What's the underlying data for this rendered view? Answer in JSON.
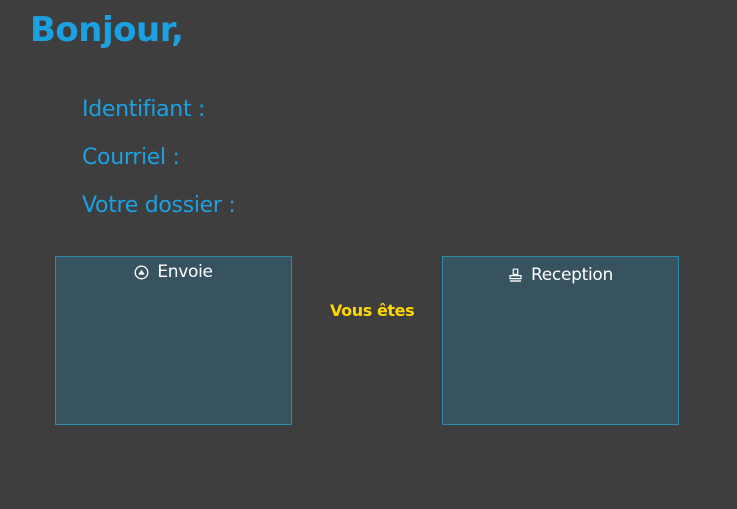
{
  "greeting": "Bonjour,",
  "user_info": {
    "identifier_label": "Identifiant :",
    "email_label": "Courriel :",
    "folder_label": "Votre dossier :"
  },
  "panels": {
    "send": {
      "label": "Envoie",
      "icon": "upload-arrow-circle-icon"
    },
    "receive": {
      "label": "Reception",
      "icon": "inbox-stamp-icon"
    }
  },
  "status_text": "Vous êtes",
  "colors": {
    "background": "#3e3e3e",
    "accent_blue": "#1ba1e2",
    "panel_fill": "#37535f",
    "panel_border": "#2d8aa8",
    "status_yellow": "#ffd700"
  }
}
